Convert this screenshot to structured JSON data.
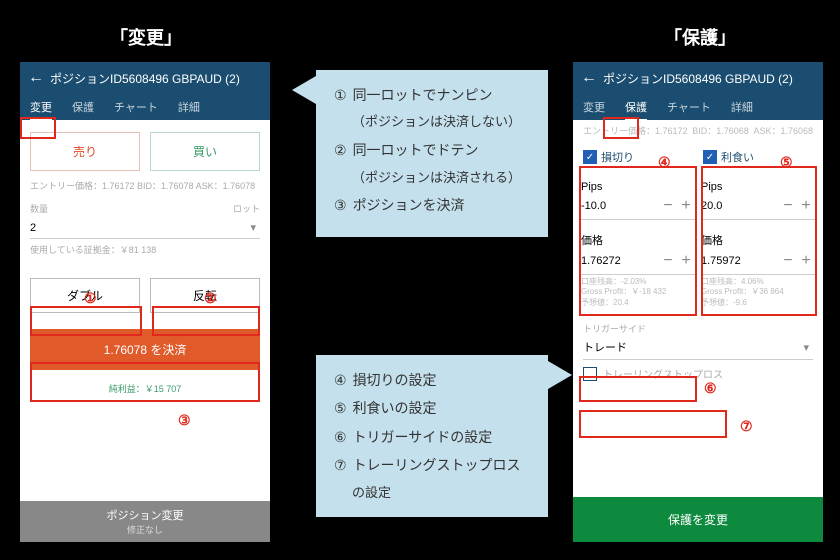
{
  "labels": {
    "left": "「変更」",
    "right": "「保護」"
  },
  "header_title": "ポジションID5608496 GBPAUD (2)",
  "left": {
    "tabs": {
      "change": "変更",
      "protect": "保護",
      "chart": "チャート",
      "detail": "詳細"
    },
    "entry_line": "エントリー価格：1.76172   BID：1.76078   ASK：1.76078",
    "sell_label": "売り",
    "buy_label": "買い",
    "qty_label": "数量",
    "lot_label": "ロット",
    "qty_value": "2",
    "margin_label": "使用している証拠金：￥81 138",
    "double_btn": "ダブル",
    "reverse_btn": "反転",
    "settle_btn": "1.76078 を決済",
    "net_pl": "純利益：￥15 707",
    "bottom_main": "ポジション変更",
    "bottom_sub": "修正なし"
  },
  "right": {
    "tabs": {
      "change": "変更",
      "protect": "保護",
      "chart": "チャート",
      "detail": "詳細"
    },
    "entry_label": "エントリー価格：1.76172",
    "bid_label": "BID：1.76068",
    "ask_label": "ASK：1.76068",
    "sl_label": "損切り",
    "tp_label": "利食い",
    "pips_label": "Pips",
    "price_label": "価格",
    "sl_pips": "-10.0",
    "tp_pips": "20.0",
    "sl_price": "1.76272",
    "tp_price": "1.75972",
    "sl_stats": {
      "bal": "口座残高：-2.03%",
      "gp": "Gross Profit：￥-18 432",
      "est": "予想値：20.4"
    },
    "tp_stats": {
      "bal": "口座残高：4.06%",
      "gp": "Gross Profit：￥36 864",
      "est": "予想値：-9.6"
    },
    "trigger_label": "トリガーサイド",
    "trigger_value": "トレード",
    "trailing_label": "トレーリングストップロス",
    "submit": "保護を変更"
  },
  "callout1": {
    "l1": "同一ロットでナンピン",
    "l1b": "（ポジションは決済しない）",
    "l2": "同一ロットでドテン",
    "l2b": "（ポジションは決済される）",
    "l3": "ポジションを決済"
  },
  "callout2": {
    "l4": "損切りの設定",
    "l5": "利食いの設定",
    "l6": "トリガーサイドの設定",
    "l7": "トレーリングストップロス",
    "l7b": "の設定"
  },
  "nums": {
    "n1": "①",
    "n2": "②",
    "n3": "③",
    "n4": "④",
    "n5": "⑤",
    "n6": "⑥",
    "n7": "⑦"
  }
}
